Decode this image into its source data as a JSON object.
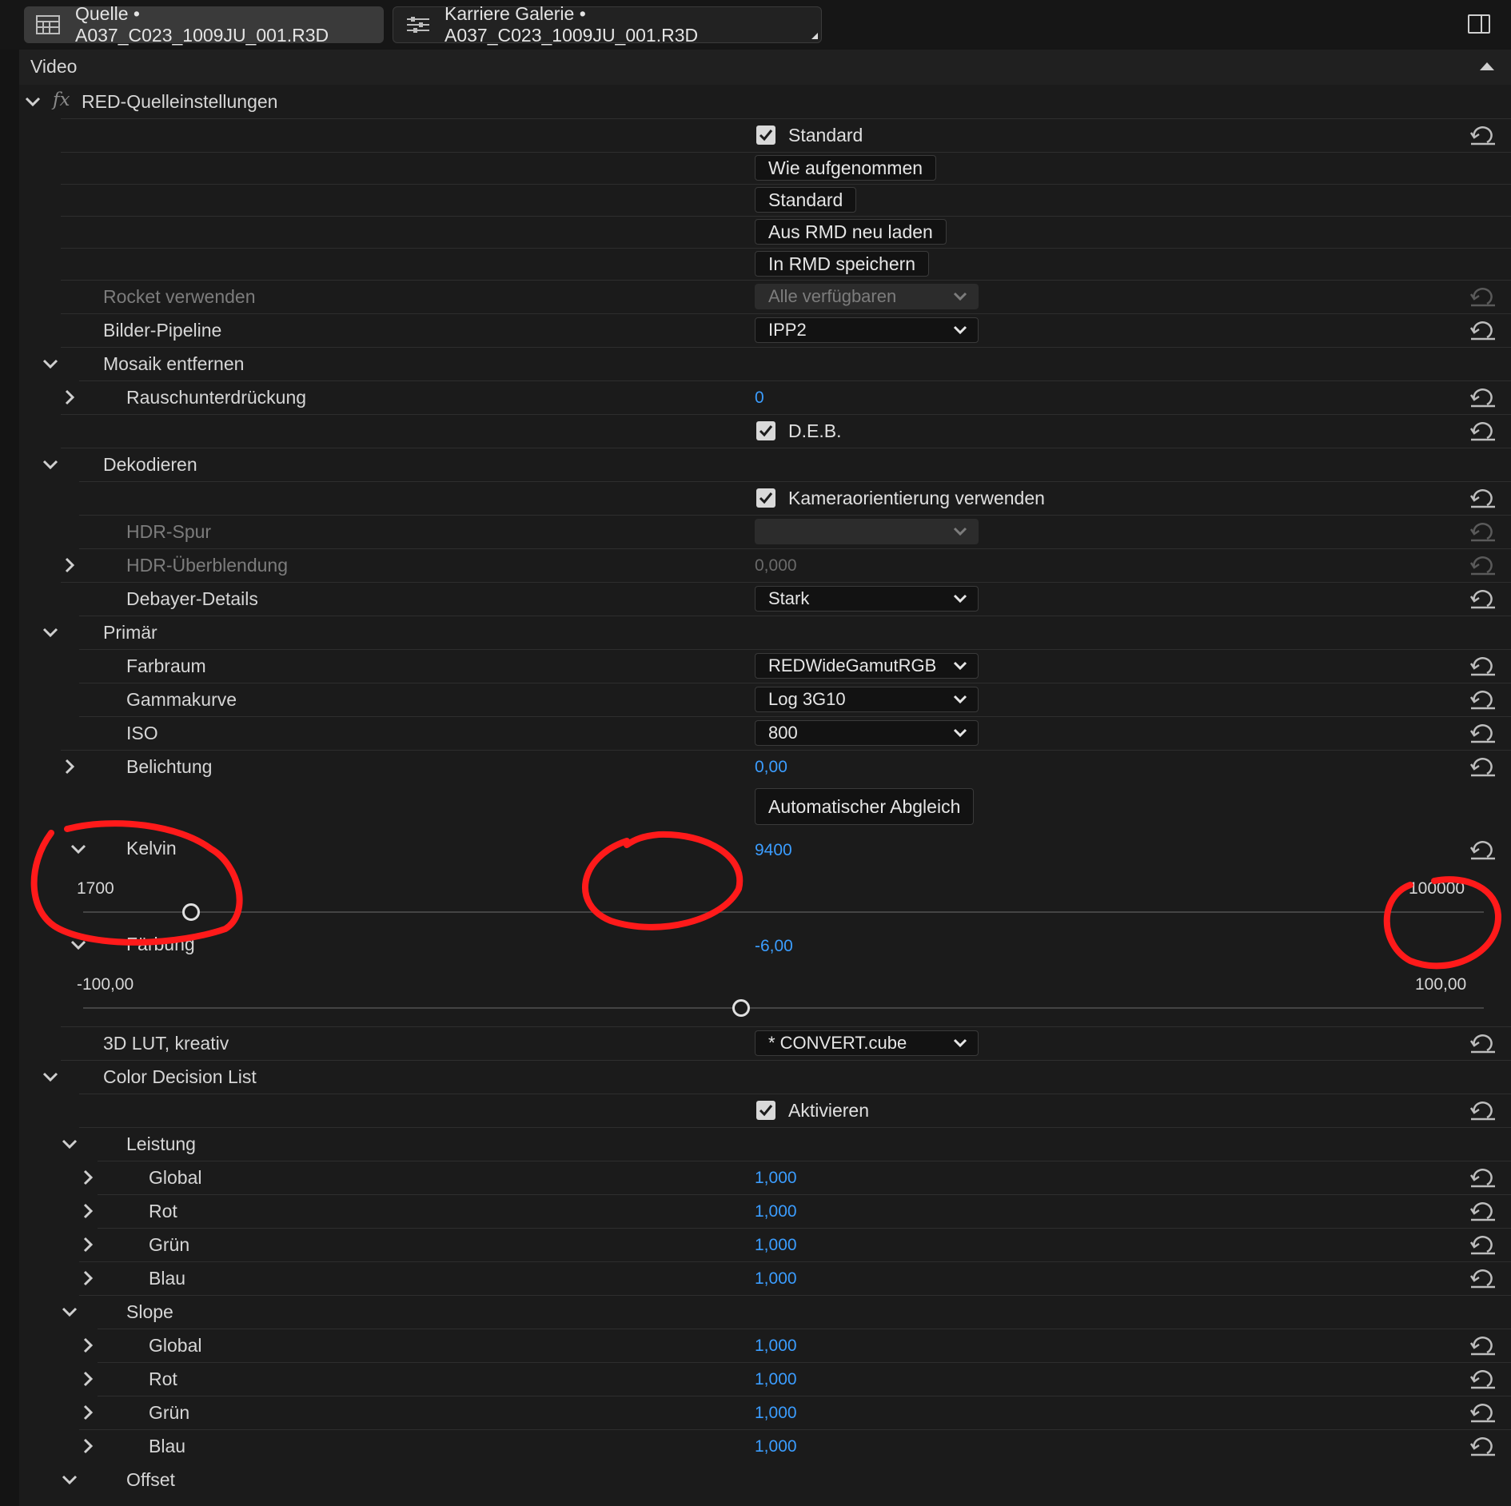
{
  "tabs": [
    {
      "label": "Quelle • A037_C023_1009JU_001.R3D",
      "active": true
    },
    {
      "label": "Karriere Galerie • A037_C023_1009JU_001.R3D",
      "active": false
    }
  ],
  "section_title": "Video",
  "effect_title": "RED-Quelleinstellungen",
  "standard_checkbox": "Standard",
  "buttons": {
    "as_shot": "Wie aufgenommen",
    "standard": "Standard",
    "reload_rmd": "Aus RMD neu laden",
    "save_rmd": "In RMD speichern",
    "auto_balance": "Automatischer Abgleich"
  },
  "rocket": {
    "label": "Rocket verwenden",
    "value": "Alle verfügbaren"
  },
  "pipeline": {
    "label": "Bilder-Pipeline",
    "value": "IPP2"
  },
  "mosaic": {
    "label": "Mosaik entfernen"
  },
  "noise": {
    "label": "Rauschunterdrückung",
    "value": "0"
  },
  "deb": {
    "label": "D.E.B."
  },
  "decode": {
    "label": "Dekodieren"
  },
  "camera_orientation": {
    "label": "Kameraorientierung verwenden"
  },
  "hdr_track": {
    "label": "HDR-Spur",
    "value": ""
  },
  "hdr_blend": {
    "label": "HDR-Überblendung",
    "value": "0,000"
  },
  "debayer": {
    "label": "Debayer-Details",
    "value": "Stark"
  },
  "primary": {
    "label": "Primär"
  },
  "colorspace": {
    "label": "Farbraum",
    "value": "REDWideGamutRGB"
  },
  "gamma": {
    "label": "Gammakurve",
    "value": "Log 3G10"
  },
  "iso": {
    "label": "ISO",
    "value": "800"
  },
  "exposure": {
    "label": "Belichtung",
    "value": "0,00"
  },
  "kelvin": {
    "label": "Kelvin",
    "value": "9400",
    "min": "1700",
    "max": "100000",
    "fraction": 0.077
  },
  "tint": {
    "label": "Färbung",
    "value": "-6,00",
    "min": "-100,00",
    "max": "100,00",
    "fraction": 0.47
  },
  "lut": {
    "label": "3D LUT, kreativ",
    "value": "* CONVERT.cube"
  },
  "cdl": {
    "label": "Color Decision List",
    "enable": "Aktivieren"
  },
  "power": {
    "label": "Leistung",
    "items": [
      {
        "label": "Global",
        "value": "1,000"
      },
      {
        "label": "Rot",
        "value": "1,000"
      },
      {
        "label": "Grün",
        "value": "1,000"
      },
      {
        "label": "Blau",
        "value": "1,000"
      }
    ]
  },
  "slope": {
    "label": "Slope",
    "items": [
      {
        "label": "Global",
        "value": "1,000"
      },
      {
        "label": "Rot",
        "value": "1,000"
      },
      {
        "label": "Grün",
        "value": "1,000"
      },
      {
        "label": "Blau",
        "value": "1,000"
      }
    ]
  },
  "offset": {
    "label": "Offset"
  },
  "colors": {
    "accent_value": "#3b9dff",
    "annotation": "#ff1a1a"
  }
}
